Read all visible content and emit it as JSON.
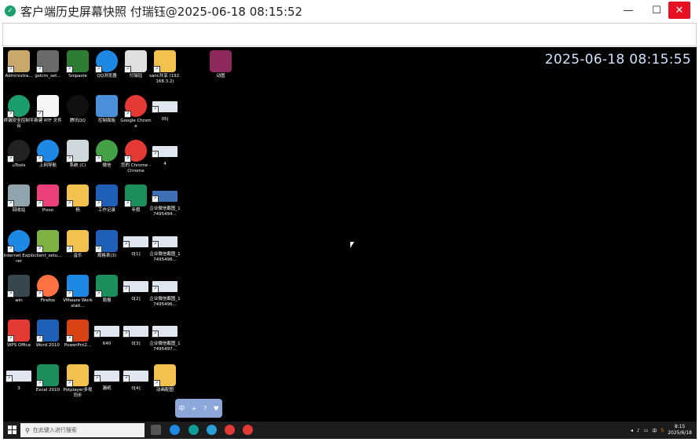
{
  "window": {
    "title": "客户端历史屏幕快照 付瑞钰@2025-06-18 08:15:52",
    "minimize": "—",
    "maximize": "☐",
    "close": "✕"
  },
  "screen": {
    "clock": "2025-06-18 08:15:55",
    "notification": [
      "中",
      "+",
      "?",
      "♥"
    ]
  },
  "desktop_icons": [
    {
      "label": "Administra...",
      "icon": "user-folder-icon",
      "color": "#c9a86a"
    },
    {
      "label": "gstcm_set...",
      "icon": "installer-icon",
      "color": "#6a6a6a"
    },
    {
      "label": "Snipaste",
      "icon": "snipaste-icon",
      "color": "#2e7d32"
    },
    {
      "label": "QQ浏览器",
      "icon": "qq-browser-icon",
      "color": "#1e88e5"
    },
    {
      "label": "付瑞钰",
      "icon": "document-icon",
      "color": "#e0e0e0"
    },
    {
      "label": "sanc共享 (192.168.3.2)",
      "icon": "shared-folder-icon",
      "color": "#f2c14e"
    },
    {
      "label": "动图",
      "icon": "winrar-icon",
      "color": "#8e2a5b"
    },
    {
      "label": "终端安全控制平台",
      "icon": "security-icon",
      "color": "#1a9e6e"
    },
    {
      "label": "新建 RTF 文件",
      "icon": "rtf-file-icon",
      "color": "#f5f5f5"
    },
    {
      "label": "腾讯QQ",
      "icon": "qq-icon",
      "color": "#111111"
    },
    {
      "label": "控制面板",
      "icon": "control-panel-icon",
      "color": "#4a90d9"
    },
    {
      "label": "Google Chrome",
      "icon": "chrome-icon",
      "color": "#e53935"
    },
    {
      "label": "05|",
      "icon": "screenshot-thumb-icon",
      "color": "#dfe6ef"
    },
    {
      "label": "uTools",
      "icon": "utools-icon",
      "color": "#222222"
    },
    {
      "label": "上网导航",
      "icon": "ie-navigation-icon",
      "color": "#1e88e5"
    },
    {
      "label": "系统 (C)",
      "icon": "drive-icon",
      "color": "#cfd8dc"
    },
    {
      "label": "微信",
      "icon": "wechat-icon",
      "color": "#43a047"
    },
    {
      "label": "您的 Chrome - Chrome",
      "icon": "chrome-profile-icon",
      "color": "#e53935"
    },
    {
      "label": "4",
      "icon": "screenshot-thumb-icon",
      "color": "#dfe6ef"
    },
    {
      "label": "回收站",
      "icon": "recycle-bin-icon",
      "color": "#90a4ae"
    },
    {
      "label": "Pixso",
      "icon": "pixso-icon",
      "color": "#ec407a"
    },
    {
      "label": "杨",
      "icon": "folder-icon",
      "color": "#f2c14e"
    },
    {
      "label": "工作记录",
      "icon": "word-doc-icon",
      "color": "#1e5fb8"
    },
    {
      "label": "年假",
      "icon": "spreadsheet-icon",
      "color": "#1a8f5b"
    },
    {
      "label": "企业微信截图_17495494...",
      "icon": "screenshot-thumb-icon",
      "color": "#3f6fb5"
    },
    {
      "label": "Internet Explorer",
      "icon": "ie-icon",
      "color": "#1e88e5"
    },
    {
      "label": "client_setu...",
      "icon": "client-setup-icon",
      "color": "#7cb342"
    },
    {
      "label": "音乐",
      "icon": "music-folder-icon",
      "color": "#f2c14e"
    },
    {
      "label": "规格表(3)",
      "icon": "word-doc-icon",
      "color": "#1e5fb8"
    },
    {
      "label": "0[1]",
      "icon": "screenshot-thumb-icon",
      "color": "#dfe6ef"
    },
    {
      "label": "企业微信截图_17495496...",
      "icon": "screenshot-thumb-icon",
      "color": "#dfe6ef"
    },
    {
      "label": "win",
      "icon": "monitor-icon",
      "color": "#37474f"
    },
    {
      "label": "Firefox",
      "icon": "firefox-icon",
      "color": "#ff7043"
    },
    {
      "label": "VMware Workstati...",
      "icon": "vmware-icon",
      "color": "#1e88e5"
    },
    {
      "label": "周报",
      "icon": "spreadsheet-icon",
      "color": "#1a8f5b"
    },
    {
      "label": "0[2]",
      "icon": "screenshot-thumb-icon",
      "color": "#dfe6ef"
    },
    {
      "label": "企业微信截图_17495496...",
      "icon": "screenshot-thumb-icon",
      "color": "#dfe6ef"
    },
    {
      "label": "WPS Office",
      "icon": "wps-icon",
      "color": "#e53935"
    },
    {
      "label": "Word 2010",
      "icon": "word-icon",
      "color": "#1e5fb8"
    },
    {
      "label": "PowerPnt2...",
      "icon": "powerpoint-icon",
      "color": "#d84315"
    },
    {
      "label": "640",
      "icon": "screenshot-thumb-icon",
      "color": "#dfe6ef"
    },
    {
      "label": "0[3]",
      "icon": "screenshot-thumb-icon",
      "color": "#dfe6ef"
    },
    {
      "label": "企业微信截图_17495497...",
      "icon": "screenshot-thumb-icon",
      "color": "#dfe6ef"
    },
    {
      "label": "3",
      "icon": "screenshot-thumb-icon",
      "color": "#dfe6ef"
    },
    {
      "label": "Excel 2010",
      "icon": "excel-icon",
      "color": "#1a8f5b"
    },
    {
      "label": "Potplayer多视同步",
      "icon": "potplayer-icon",
      "color": "#f2c14e"
    },
    {
      "label": "漏纸",
      "icon": "screenshot-thumb-icon",
      "color": "#dfe6ef"
    },
    {
      "label": "0[4]",
      "icon": "screenshot-thumb-icon",
      "color": "#dfe6ef"
    },
    {
      "label": "动画配图",
      "icon": "image-file-icon",
      "color": "#f2c14e"
    }
  ],
  "taskbar": {
    "search_placeholder": "在此键入进行搜索",
    "tray_text": "中",
    "time": "8:15",
    "date": "2025/6/18"
  }
}
